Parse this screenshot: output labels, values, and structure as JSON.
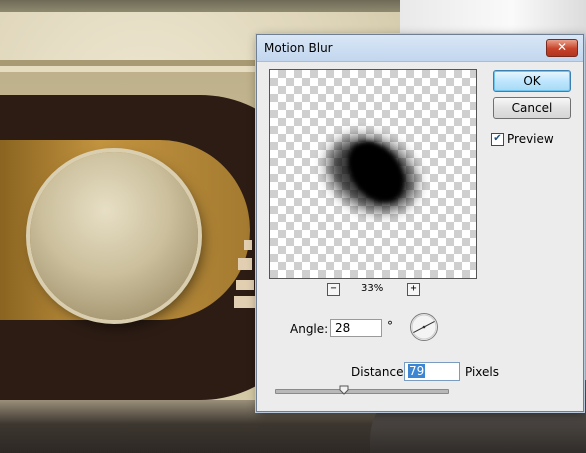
{
  "dialog": {
    "title": "Motion Blur",
    "close_icon": "close-icon",
    "ok_label": "OK",
    "cancel_label": "Cancel",
    "preview_checkbox": {
      "label": "Preview",
      "checked": true
    },
    "zoom": {
      "value": "33%",
      "minus_icon": "zoom-out-icon",
      "plus_icon": "zoom-in-icon"
    },
    "angle": {
      "label": "Angle:",
      "value": "28",
      "unit": "°"
    },
    "distance": {
      "label": "Distance:",
      "value": "79",
      "unit": "Pixels",
      "slider_fraction": 0.4
    },
    "colors": {
      "title_bar": "#c9dbf0",
      "close": "#c7422a",
      "default_button": "#a7d9f5",
      "selection": "#3c86d4"
    }
  }
}
